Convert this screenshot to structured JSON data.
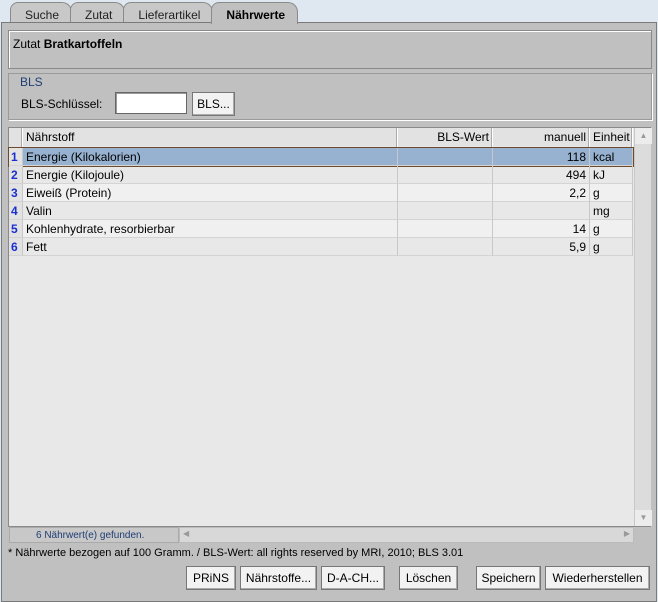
{
  "tabs": [
    "Suche",
    "Zutat",
    "Lieferartikel",
    "Nährwerte"
  ],
  "header": {
    "prefix": "Zutat",
    "name": "Bratkartoffeln"
  },
  "bls": {
    "legend": "BLS",
    "key_label": "BLS-Schlüssel:",
    "key_value": "",
    "button": "BLS..."
  },
  "table": {
    "columns": [
      "",
      "Nährstoff",
      "BLS-Wert",
      "manuell",
      "Einheit"
    ],
    "rows": [
      {
        "n": "1",
        "name": "Energie (Kilokalorien)",
        "bls": "",
        "manual": "118",
        "unit": "kcal"
      },
      {
        "n": "2",
        "name": "Energie (Kilojoule)",
        "bls": "",
        "manual": "494",
        "unit": "kJ"
      },
      {
        "n": "3",
        "name": "Eiweiß (Protein)",
        "bls": "",
        "manual": "2,2",
        "unit": "g"
      },
      {
        "n": "4",
        "name": "Valin",
        "bls": "",
        "manual": "",
        "unit": "mg"
      },
      {
        "n": "5",
        "name": "Kohlenhydrate, resorbierbar",
        "bls": "",
        "manual": "14",
        "unit": "g"
      },
      {
        "n": "6",
        "name": "Fett",
        "bls": "",
        "manual": "5,9",
        "unit": "g"
      }
    ]
  },
  "status": "6  Nährwert(e) gefunden.",
  "footnote": "* Nährwerte bezogen auf 100 Gramm. / BLS-Wert: all rights reserved by MRI, 2010; BLS 3.01",
  "buttons": {
    "prins": "PRiNS",
    "naehrstoffe": "Nährstoffe...",
    "dach": "D-A-CH...",
    "loeschen": "Löschen",
    "speichern": "Speichern",
    "wiederherstellen": "Wiederherstellen"
  }
}
